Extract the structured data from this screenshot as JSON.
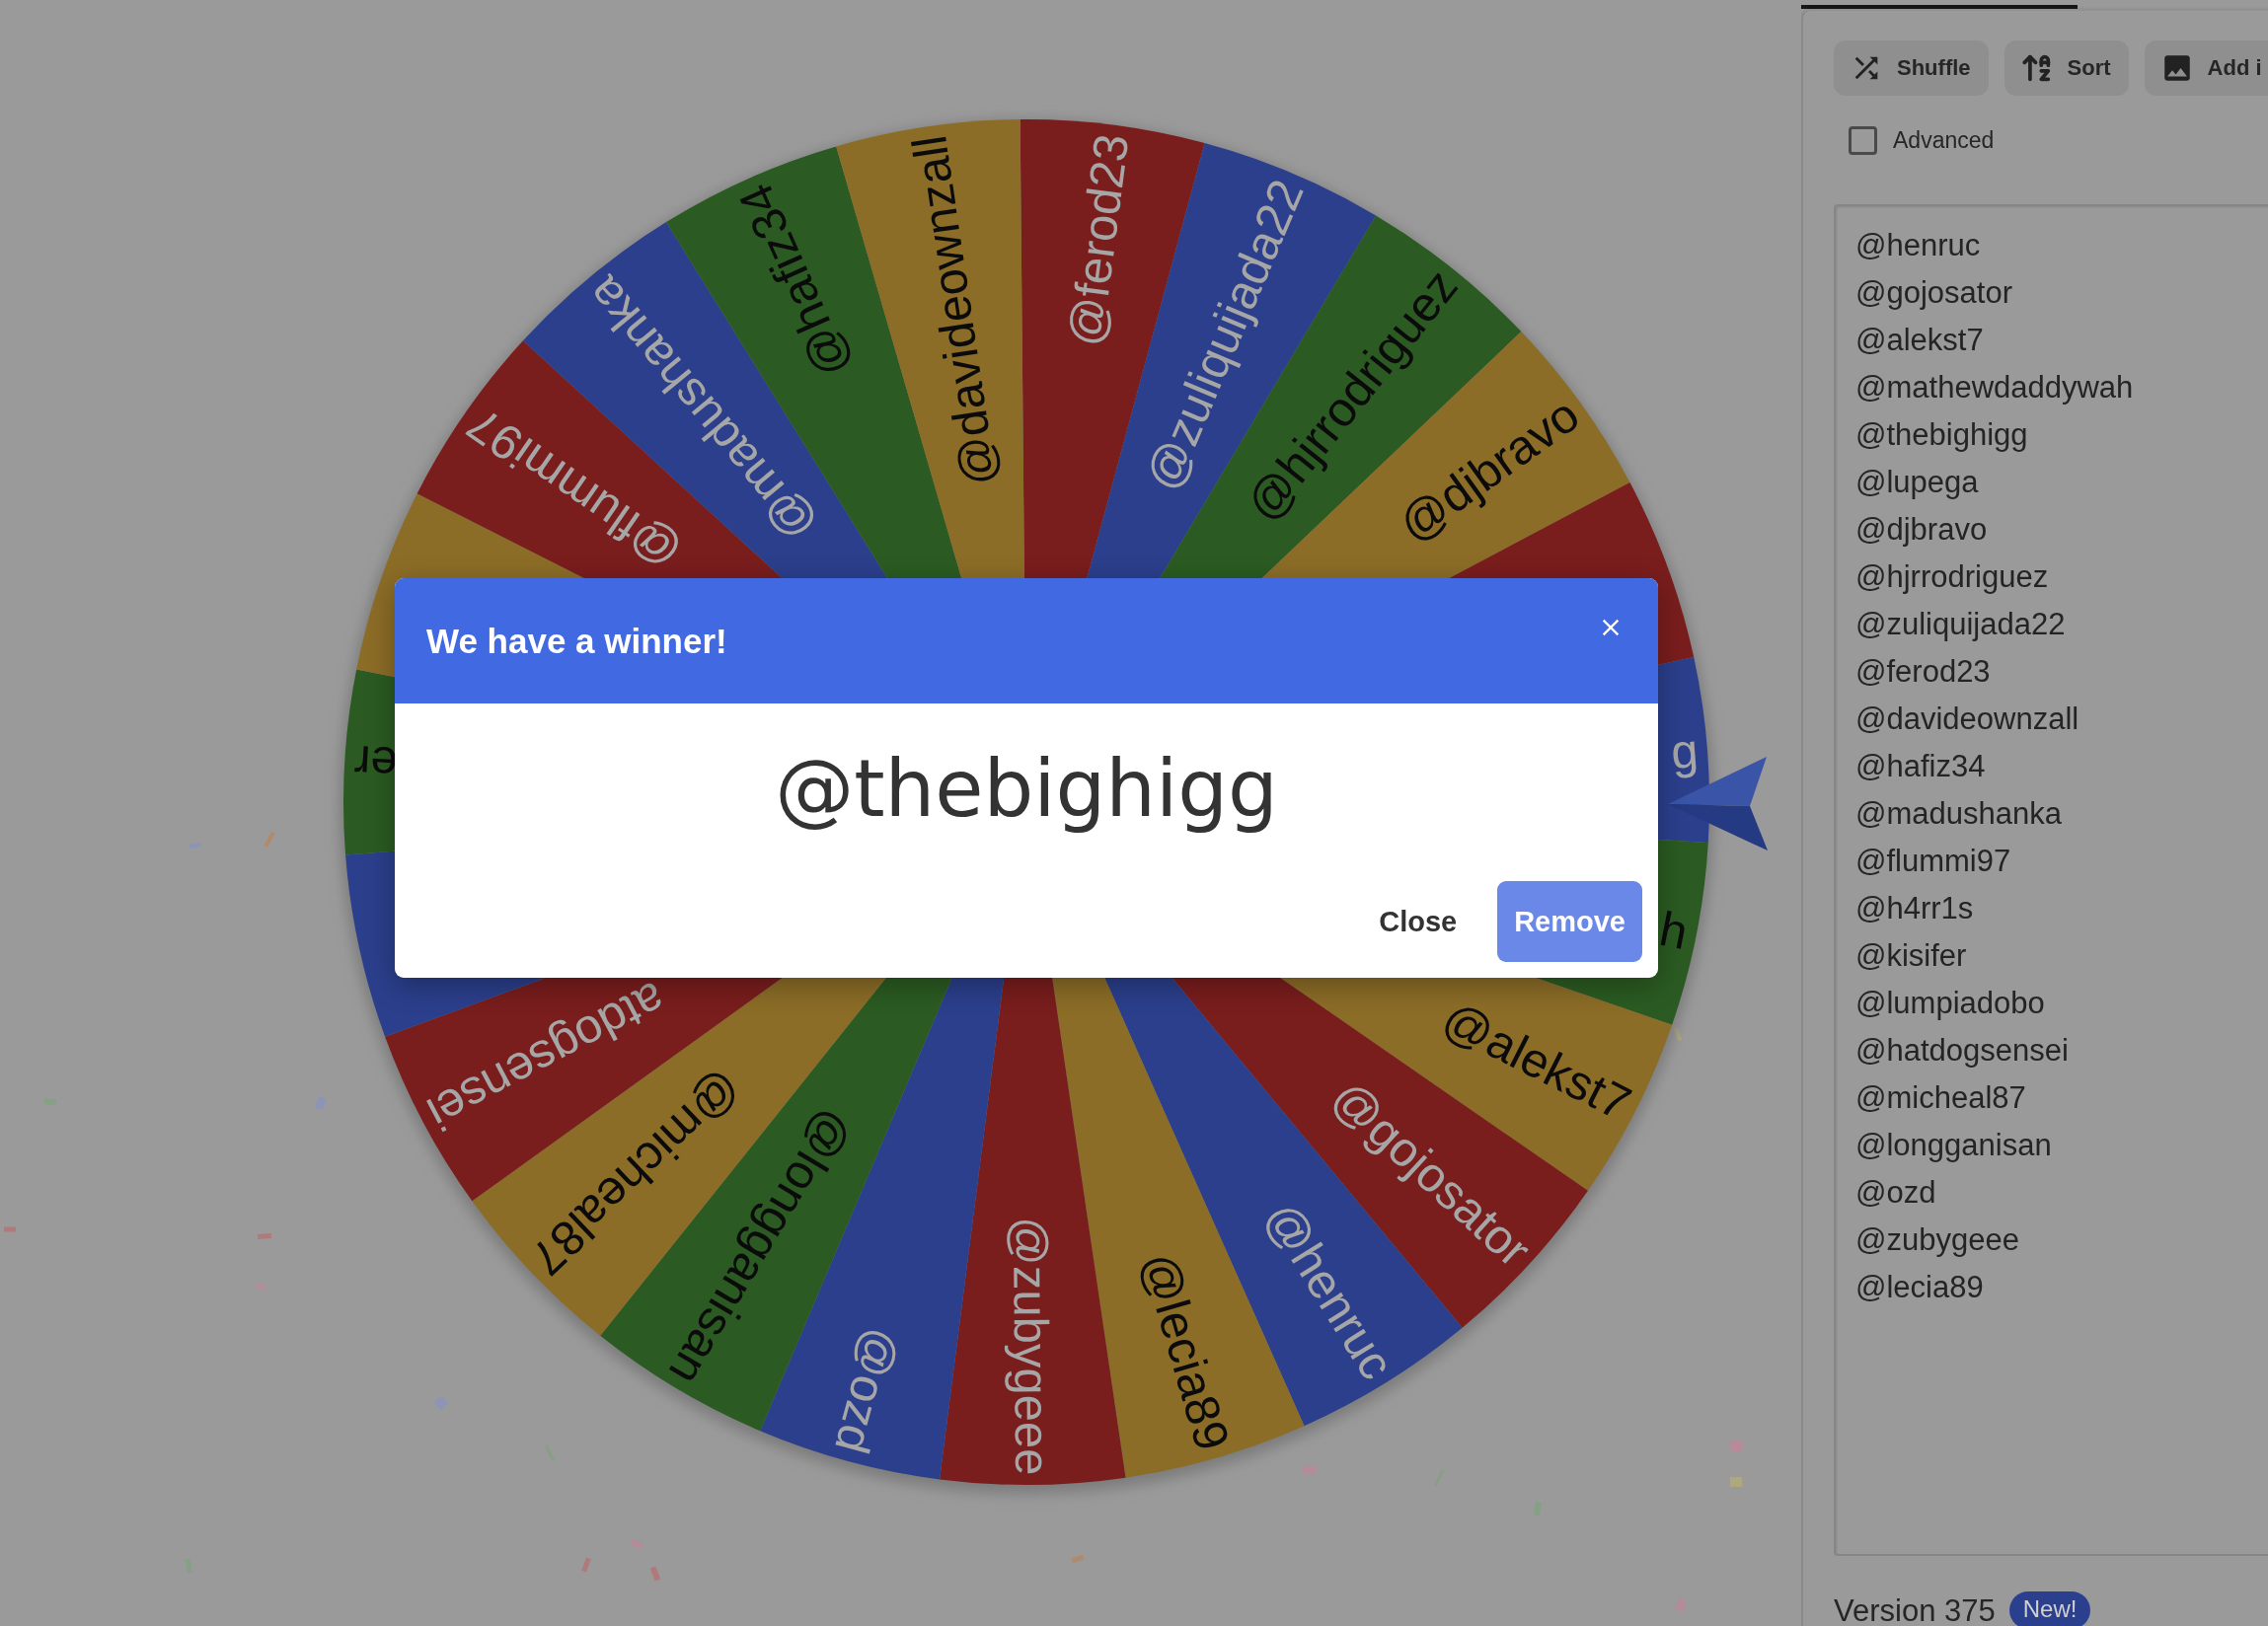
{
  "wheel": {
    "segments": [
      {
        "label": "@ferod23",
        "color": "#7a1d1d"
      },
      {
        "label": "@zuliquijada22",
        "color": "#2b3f8c"
      },
      {
        "label": "@hjrrodriguez",
        "color": "#2b5b22"
      },
      {
        "label": "@djbravo",
        "color": "#8c6d27"
      },
      {
        "color": "#7a1d1d"
      },
      {
        "label": "g",
        "color": "#2b3f8c"
      },
      {
        "label": "h",
        "color": "#2b5b22"
      },
      {
        "label": "@alekst7",
        "color": "#8c6d27"
      },
      {
        "label": "@gojosator",
        "color": "#7a1d1d"
      },
      {
        "label": "@henruc",
        "color": "#2b3f8c"
      },
      {
        "label": "@lecia89",
        "color": "#8c6d27"
      },
      {
        "label": "@zubygeee",
        "color": "#7a1d1d"
      },
      {
        "label": "@ozd",
        "color": "#2b3f8c"
      },
      {
        "label": "@longganisan",
        "color": "#2b5b22"
      },
      {
        "label": "@micheal87",
        "color": "#8c6d27"
      },
      {
        "label": "atdogsensei",
        "color": "#7a1d1d"
      },
      {
        "color": "#2b3f8c"
      },
      {
        "label": "er",
        "color": "#2b5b22"
      },
      {
        "color": "#8c6d27"
      },
      {
        "label": "@flummi97",
        "color": "#7a1d1d"
      },
      {
        "label": "@madushanka",
        "color": "#2b3f8c"
      },
      {
        "label": "@hafiz34",
        "color": "#2b5b22"
      },
      {
        "label": "@davideownzall",
        "color": "#8c6d27"
      }
    ]
  },
  "winner_dialog": {
    "title": "We have a winner!",
    "winner": "@thebighigg",
    "buttons": [
      {
        "kind": "text",
        "label": "Close"
      },
      {
        "kind": "filled",
        "label": "Remove"
      }
    ]
  },
  "toolbar": [
    {
      "kind": "shuffle",
      "label": "Shuffle"
    },
    {
      "kind": "sort",
      "label": "Sort"
    },
    {
      "kind": "image",
      "label": "Add i"
    }
  ],
  "advanced": {
    "label": "Advanced",
    "checked": false
  },
  "entries": [
    "@henruc",
    "@gojosator",
    "@alekst7",
    "@mathewdaddywah",
    "@thebighigg",
    "@lupega",
    "@djbravo",
    "@hjrrodriguez",
    "@zuliquijada22",
    "@ferod23",
    "@davideownzall",
    "@hafiz34",
    "@madushanka",
    "@flummi97",
    "@h4rr1s",
    "@kisifer",
    "@lumpiadobo",
    "@hatdogsensei",
    "@micheal87",
    "@longganisan",
    "@ozd",
    "@zubygeee",
    "@lecia89"
  ],
  "version": {
    "label": "Version 375",
    "badge": "New!"
  }
}
